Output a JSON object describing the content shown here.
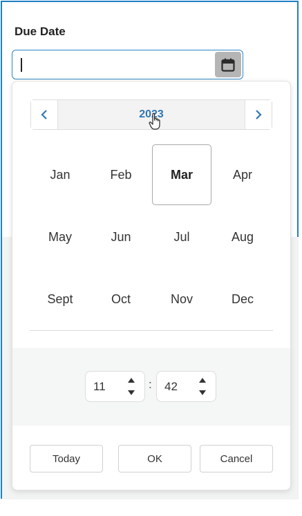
{
  "field": {
    "label": "Due Date",
    "value": ""
  },
  "picker": {
    "year": "2023",
    "months": [
      "Jan",
      "Feb",
      "Mar",
      "Apr",
      "May",
      "Jun",
      "Jul",
      "Aug",
      "Sept",
      "Oct",
      "Nov",
      "Dec"
    ],
    "selected_month": "Mar"
  },
  "time": {
    "hour": "11",
    "minute": "42",
    "separator": ":"
  },
  "buttons": {
    "today": "Today",
    "ok": "OK",
    "cancel": "Cancel"
  },
  "colors": {
    "accent": "#2f76b5",
    "border_focus": "#2a84c4",
    "frame": "#1e7fc6"
  }
}
